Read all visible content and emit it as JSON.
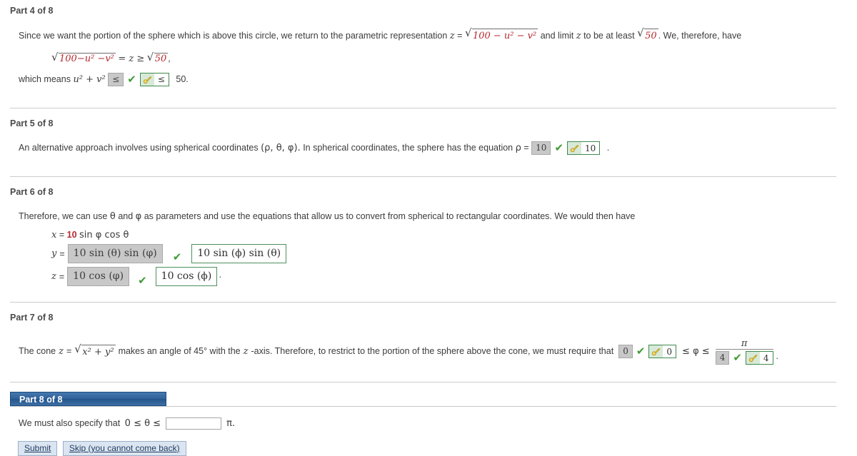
{
  "colors": {
    "accent_number": "#b5292f",
    "check_green": "#3f9c35",
    "key_border": "#3f8a4e",
    "key_bg": "#d7ead9",
    "student_box_bg": "#c8c8c8",
    "part8_header_bg": "#2f6098"
  },
  "parts": [
    {
      "label": "Part 4 of 8",
      "line1_a": "Since we want the portion of the sphere which is above this circle, we return to the parametric representation",
      "line1_z": "z",
      "line1_eq": "=",
      "line1_rad": "100 − u² − v²",
      "line1_b": "and limit",
      "line1_z2": "z",
      "line1_c": "to be at least",
      "line1_rad2": "50",
      "line1_d": ". We, therefore, have",
      "eq_line_rad": "100−u² −v²",
      "eq_line_mid": "= z ≥",
      "eq_line_rad2": "50",
      "eq_line_comma": ",",
      "line3_a": "which means",
      "line3_expr": "u² + v²",
      "student_answer": "≤",
      "key_answer": "≤",
      "line3_tail": "50."
    },
    {
      "label": "Part 5 of 8",
      "text_a": "An alternative approach involves using spherical coordinates",
      "coords": "(ρ, θ, φ).",
      "text_b": "In spherical coordinates, the sphere has the equation",
      "rho": "ρ",
      "equals": "=",
      "student_answer": "10",
      "key_answer": "10",
      "tail": "."
    },
    {
      "label": "Part 6 of 8",
      "text_a": "Therefore, we can use",
      "theta": "θ",
      "text_and": "and",
      "phi": "φ",
      "text_b": "as parameters and use the equations that allow us to convert from spherical to rectangular coordinates. We would then have",
      "rows": [
        {
          "var": "x",
          "equals": "=",
          "given_number": "10",
          "given_rest": "sin φ cos θ",
          "has_box": false
        },
        {
          "var": "y",
          "equals": "=",
          "student_answer": "10 sin (θ) sin (φ)",
          "key_answer": "10 sin (ϕ) sin (θ)",
          "has_box": true
        },
        {
          "var": "z",
          "equals": "=",
          "student_answer": "10 cos (φ)",
          "key_answer": "10 cos (ϕ)",
          "has_box": true,
          "trailing": "·"
        }
      ]
    },
    {
      "label": "Part 7 of 8",
      "text_a": "The cone",
      "z": "z",
      "equals": "=",
      "rad": "x² + y²",
      "text_b": "makes an angle of 45° with the",
      "z_axis": "z",
      "text_c": "-axis. Therefore, to restrict to the portion of the sphere above the cone, we must require that",
      "lower_student": "0",
      "lower_key": "0",
      "middle": "≤ φ ≤",
      "frac_numerator": "π",
      "upper_student": "4",
      "upper_key": "4",
      "tail": "."
    },
    {
      "label": "Part 8 of 8",
      "text_a": "We must also specify that",
      "inequality": "0 ≤ θ ≤",
      "input_value": "",
      "input_placeholder": "",
      "tail": "π.",
      "buttons": [
        {
          "label": "Submit",
          "name": "submit-button"
        },
        {
          "label": "Skip (you cannot come back)",
          "name": "skip-button"
        }
      ]
    }
  ],
  "icons": {
    "check": "✔",
    "key": "key-icon",
    "radical": "√"
  }
}
